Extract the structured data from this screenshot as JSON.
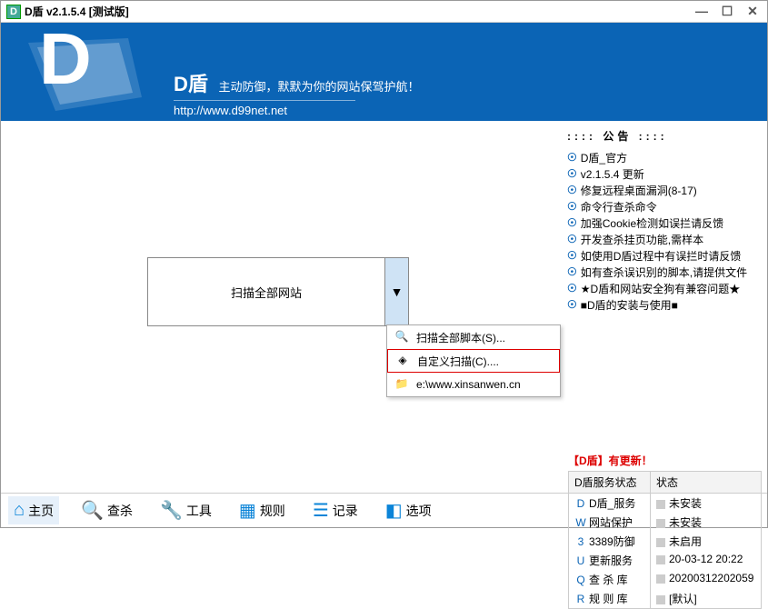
{
  "window": {
    "title": "D盾 v2.1.5.4 [测试版]"
  },
  "banner": {
    "title": "D盾",
    "slogan": "主动防御，默默为你的网站保驾护航！",
    "url": "http://www.d99net.net"
  },
  "scan": {
    "label": "扫描全部网站"
  },
  "menu": {
    "items": [
      {
        "label": "扫描全部脚本(S)...",
        "icon": "🔍"
      },
      {
        "label": "自定义扫描(C)....",
        "icon": "◈",
        "selected": true
      },
      {
        "label": "e:\\www.xinsanwen.cn",
        "icon": "📁"
      }
    ]
  },
  "notice": {
    "header": ":::: 公告 ::::",
    "items": [
      "D盾_官方",
      "v2.1.5.4 更新",
      "修复远程桌面漏洞(8-17)",
      "命令行查杀命令",
      "加强Cookie检测如误拦请反馈",
      "开发查杀挂页功能,需样本",
      "如使用D盾过程中有误拦时请反馈",
      "如有查杀误识别的脚本,请提供文件",
      "★D盾和网站安全狗有兼容问题★",
      "■D盾的安装与使用■"
    ]
  },
  "update": {
    "label": "【D盾】有更新！"
  },
  "status": {
    "header": {
      "c1": "D盾服务状态",
      "c2": "状态"
    },
    "rows": [
      {
        "icon": "D",
        "name": "D盾_服务",
        "value": "未安装"
      },
      {
        "icon": "W",
        "name": "网站保护",
        "value": "未安装"
      },
      {
        "icon": "3",
        "name": "3389防御",
        "value": "未启用"
      },
      {
        "icon": "U",
        "name": "更新服务",
        "value": "20-03-12 20:22"
      },
      {
        "icon": "Q",
        "name": "查 杀 库",
        "value": "20200312202059"
      },
      {
        "icon": "R",
        "name": "规 则 库",
        "value": "[默认]"
      }
    ]
  },
  "tabs": {
    "items": [
      {
        "icon": "⌂",
        "label": "主页",
        "active": true
      },
      {
        "icon": "🔍",
        "label": "查杀"
      },
      {
        "icon": "🔧",
        "label": "工具"
      },
      {
        "icon": "▦",
        "label": "规则"
      },
      {
        "icon": "☰",
        "label": "记录"
      },
      {
        "icon": "◧",
        "label": "选项"
      }
    ]
  }
}
